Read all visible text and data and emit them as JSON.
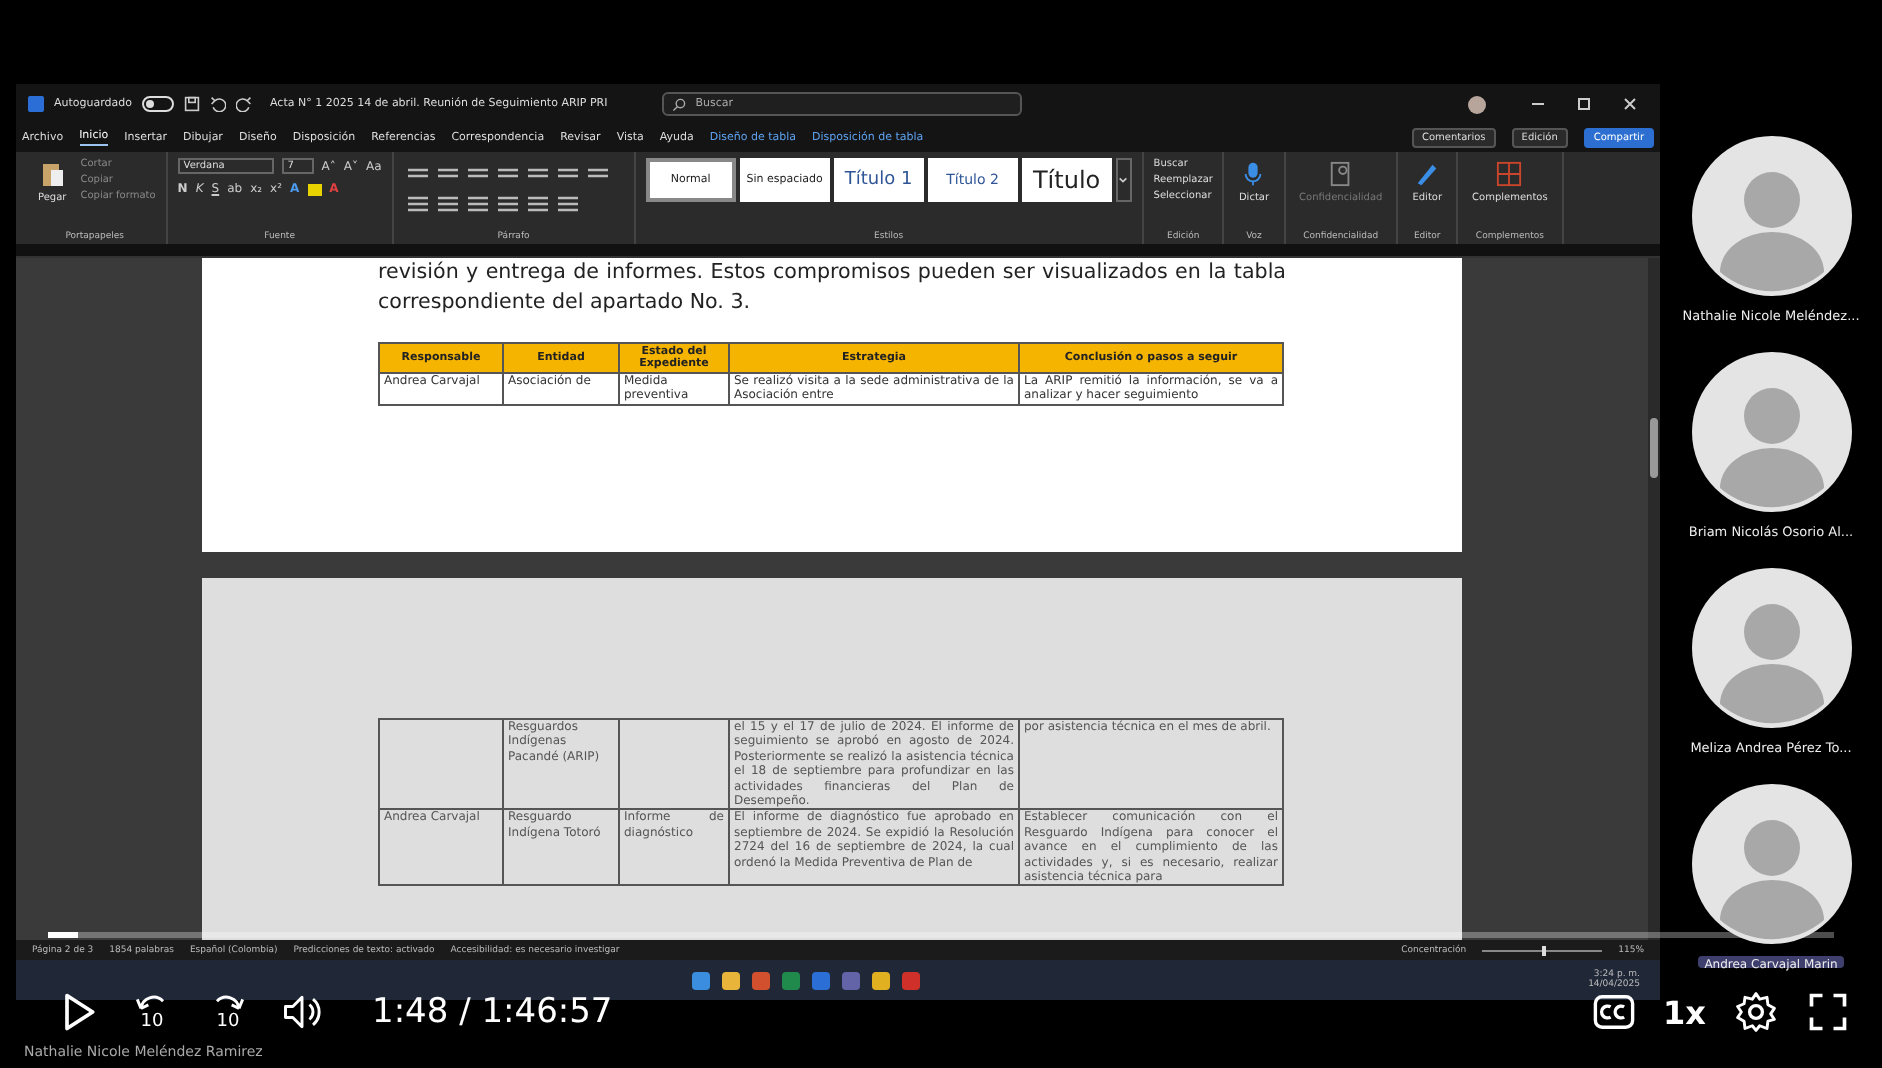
{
  "window": {
    "autosave_label": "Autoguardado",
    "autosave_on": false,
    "title": "Acta N° 1 2025 14 de abril. Reunión de Seguimiento ARIP PRI",
    "search": {
      "placeholder": "Buscar"
    }
  },
  "tabs": [
    {
      "label": "Archivo",
      "selected": false,
      "kind": "main"
    },
    {
      "label": "Inicio",
      "selected": true,
      "kind": "main"
    },
    {
      "label": "Insertar",
      "selected": false,
      "kind": "main"
    },
    {
      "label": "Dibujar",
      "selected": false,
      "kind": "main"
    },
    {
      "label": "Diseño",
      "selected": false,
      "kind": "main"
    },
    {
      "label": "Disposición",
      "selected": false,
      "kind": "main"
    },
    {
      "label": "Referencias",
      "selected": false,
      "kind": "main"
    },
    {
      "label": "Correspondencia",
      "selected": false,
      "kind": "main"
    },
    {
      "label": "Revisar",
      "selected": false,
      "kind": "main"
    },
    {
      "label": "Vista",
      "selected": false,
      "kind": "main"
    },
    {
      "label": "Ayuda",
      "selected": false,
      "kind": "main"
    },
    {
      "label": "Diseño de tabla",
      "selected": false,
      "kind": "contextual"
    },
    {
      "label": "Disposición de tabla",
      "selected": false,
      "kind": "contextual"
    }
  ],
  "actions": [
    {
      "label": "Comentarios",
      "kind": "comments"
    },
    {
      "label": "Edición",
      "kind": "editing"
    },
    {
      "label": "Compartir",
      "kind": "share"
    }
  ],
  "ribbon": [
    {
      "kind": "clipboard",
      "label": "Portapapeles",
      "big": "Pegar",
      "small": [
        "Cortar",
        "Copiar",
        "Copiar formato"
      ]
    },
    {
      "kind": "font",
      "label": "Fuente",
      "font_name": "Verdana",
      "font_size": "7",
      "size_buttons": [
        "A˄",
        "A˅",
        "Aa"
      ],
      "format_buttons": [
        {
          "label": "N",
          "kind": "bold"
        },
        {
          "label": "K",
          "kind": "italic"
        },
        {
          "label": "S",
          "kind": "underline"
        },
        {
          "label": "ab",
          "kind": "plain"
        },
        {
          "label": "x₂",
          "kind": "plain"
        },
        {
          "label": "x²",
          "kind": "plain"
        },
        {
          "label": "A",
          "kind": "effects"
        },
        {
          "label": "A",
          "kind": "color"
        }
      ]
    },
    {
      "kind": "paragraph",
      "label": "Párrafo"
    },
    {
      "kind": "styles",
      "label": "Estilos",
      "styles": [
        {
          "label": "Normal",
          "selected": true
        },
        {
          "label": "Sin espaciado",
          "selected": false
        },
        {
          "label": "Título 1",
          "selected": false
        },
        {
          "label": "Título 2",
          "selected": false
        },
        {
          "label": "Título",
          "selected": false
        }
      ]
    },
    {
      "kind": "small_list",
      "label": "Edición",
      "small": [
        "Buscar",
        "Reemplazar",
        "Seleccionar"
      ]
    },
    {
      "kind": "dictate",
      "label": "Voz",
      "button": "Dictar",
      "disabled": false
    },
    {
      "kind": "sensitivity",
      "label": "Confidencialidad",
      "button": "Confidencialidad",
      "disabled": true
    },
    {
      "kind": "editor",
      "label": "Editor",
      "button": "Editor",
      "disabled": false
    },
    {
      "kind": "addins",
      "label": "Complementos",
      "button": "Complementos",
      "disabled": false
    }
  ],
  "document": {
    "paragraph": "revisión y entrega de informes. Estos compromisos pueden ser visualizados en la tabla correspondiente del apartado No. 3.",
    "columns": [
      "Responsable",
      "Entidad",
      "Estado del Expediente",
      "Estrategia",
      "Conclusión o pasos a seguir"
    ],
    "rows_page_1": [
      {
        "responsable": "Andrea Carvajal",
        "entidad": "Asociación de",
        "estado": "Medida preventiva",
        "estrategia": "Se realizó visita a la sede administrativa de la Asociación entre",
        "conclusion": "La ARIP remitió la información, se va a analizar y hacer seguimiento"
      }
    ],
    "rows_page_2": [
      {
        "entidad": "Resguardos Indígenas Pacandé (ARIP)",
        "estrategia": "el 15 y el 17 de julio de 2024. El informe de seguimiento se aprobó en agosto de 2024. Posteriormente se realizó la asistencia técnica el 18 de septiembre para profundizar en las actividades financieras del Plan de Desempeño.",
        "conclusion": "por asistencia técnica en el mes de abril."
      },
      {
        "responsable": "Andrea Carvajal",
        "entidad": "Resguardo Indígena Totoró",
        "estado": "Informe de diagnóstico",
        "estrategia": "El informe de diagnóstico fue aprobado en septiembre de 2024. Se expidió la Resolución 2724 del 16 de septiembre de 2024, la cual ordenó la Medida Preventiva de Plan de",
        "conclusion": "Establecer comunicación con el Resguardo Indígena para conocer el avance en el cumplimiento de las actividades y, si es necesario, realizar asistencia técnica para"
      }
    ]
  },
  "status_bar": {
    "left": [
      "Página 2 de 3",
      "1854 palabras",
      "Español (Colombia)",
      "Predicciones de texto: activado",
      "Accesibilidad: es necesario investigar"
    ],
    "focus": "Concentración",
    "zoom": {
      "level": 0.5,
      "reading": "115%"
    }
  },
  "taskbar": {
    "apps": [
      {
        "kind": "start"
      },
      {
        "kind": "folder"
      },
      {
        "kind": "powerpoint"
      },
      {
        "kind": "excel"
      },
      {
        "kind": "word"
      },
      {
        "kind": "teams"
      },
      {
        "kind": "chrome"
      },
      {
        "kind": "pdf"
      }
    ],
    "time": "3:24 p. m.",
    "date": "14/04/2025"
  },
  "participants": [
    {
      "name": "Nathalie Nicole Meléndez...",
      "highlighted": false
    },
    {
      "name": "Briam Nicolás Osorio Al...",
      "highlighted": false
    },
    {
      "name": "Meliza Andrea Pérez To...",
      "highlighted": false
    },
    {
      "name": "Andrea Carvajal Marin",
      "highlighted": true
    }
  ],
  "player": {
    "progress": {
      "level": 0.017
    },
    "skip_back": "10",
    "skip_forward": "10",
    "time": "1:48 / 1:46:57",
    "speed": "1x",
    "caption": "Nathalie Nicole Meléndez Ramirez"
  }
}
